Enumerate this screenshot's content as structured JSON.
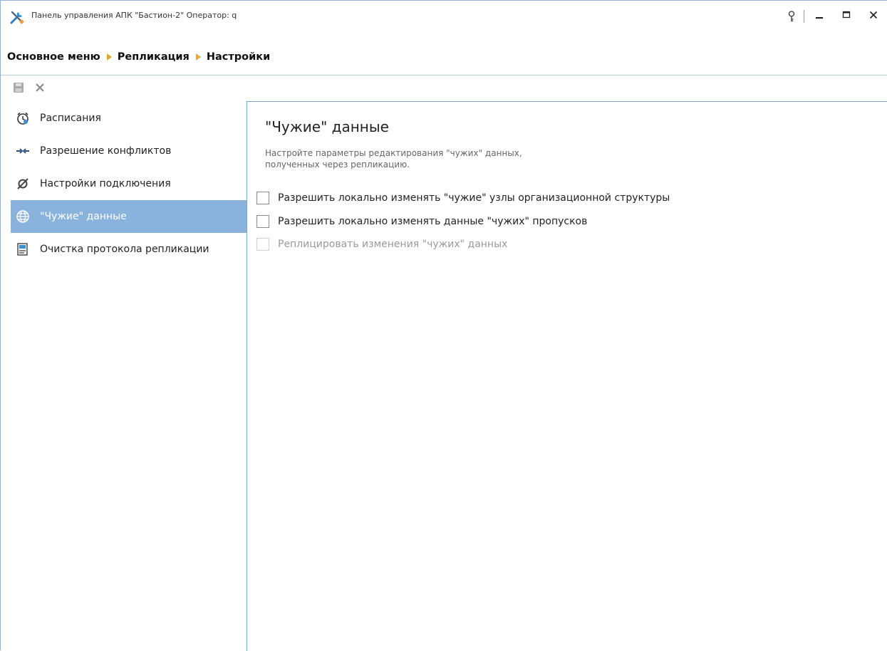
{
  "window": {
    "title": "Панель управления АПК \"Бастион-2\"  Оператор: q",
    "controls": {
      "help_icon": "key-icon",
      "minimize_icon": "minimize-icon",
      "maximize_icon": "maximize-icon",
      "close_icon": "close-icon"
    }
  },
  "breadcrumb": {
    "items": [
      "Основное меню",
      "Репликация",
      "Настройки"
    ]
  },
  "toolbar": {
    "buttons": [
      {
        "name": "save",
        "icon": "save-icon",
        "enabled": false
      },
      {
        "name": "cancel",
        "icon": "close-icon",
        "enabled": false
      }
    ]
  },
  "sidebar": {
    "items": [
      {
        "label": "Расписания",
        "icon": "alarm-clock-icon",
        "selected": false
      },
      {
        "label": "Разрешение конфликтов",
        "icon": "conflict-arrows-icon",
        "selected": false
      },
      {
        "label": "Настройки подключения",
        "icon": "disconnected-plug-icon",
        "selected": false
      },
      {
        "label": "\"Чужие\" данные",
        "icon": "globe-icon",
        "selected": true
      },
      {
        "label": "Очистка протокола репликации",
        "icon": "clear-log-icon",
        "selected": false
      }
    ]
  },
  "content": {
    "title": "\"Чужие\" данные",
    "description_line1": "Настройте параметры редактирования \"чужих\" данных,",
    "description_line2": "полученных через репликацию.",
    "checkboxes": [
      {
        "label": "Разрешить локально изменять \"чужие\" узлы организационной структуры",
        "checked": false,
        "enabled": true
      },
      {
        "label": "Разрешить локально изменять данные \"чужих\" пропусков",
        "checked": false,
        "enabled": true
      },
      {
        "label": "Реплицировать изменения \"чужих\" данных",
        "checked": false,
        "enabled": false
      }
    ]
  },
  "colors": {
    "selected_bg": "#89b3dd",
    "frame_border": "#7ea6d0",
    "breadcrumb_arrow": "#e8a23a"
  }
}
